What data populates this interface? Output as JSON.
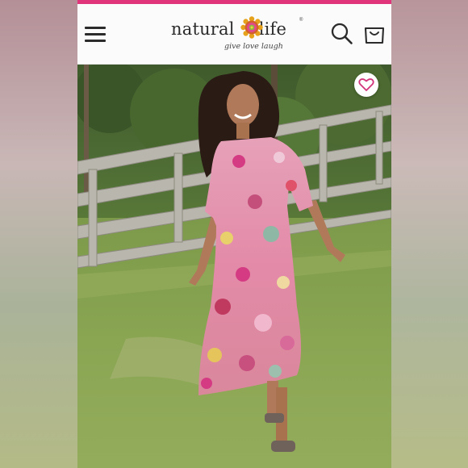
{
  "header": {
    "brand_left": "natural",
    "brand_right": "life",
    "tagline": "give love laugh",
    "registered_mark": "®",
    "accent_color": "#e0357a"
  },
  "icons": {
    "menu": "hamburger-menu-icon",
    "search": "search-icon",
    "cart": "shopping-bag-icon",
    "favorite": "heart-icon"
  },
  "product_photo": {
    "subject": "woman in floral maxi dress walking on grass by wooden fence"
  }
}
